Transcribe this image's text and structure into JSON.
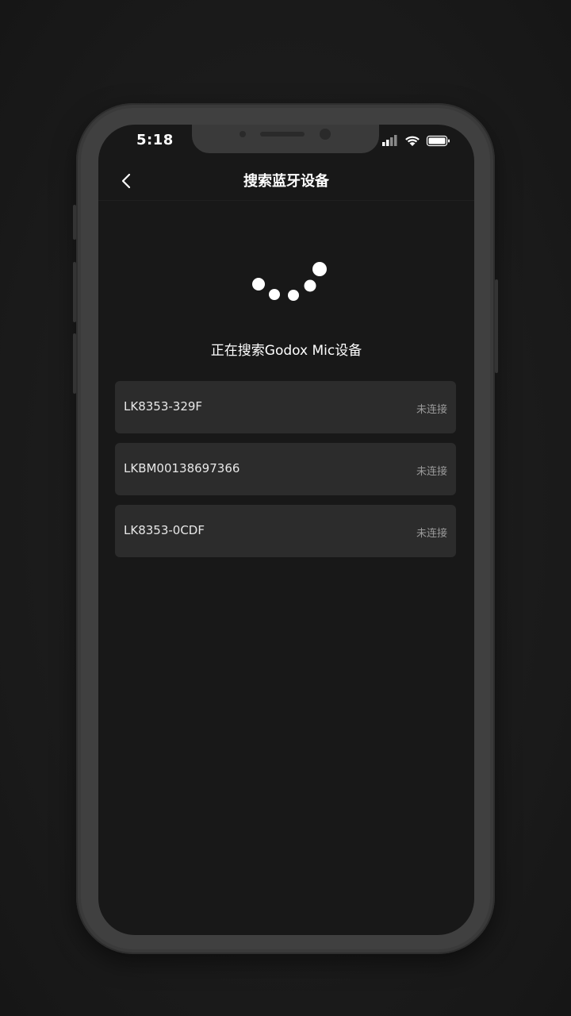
{
  "status_bar": {
    "time": "5:18"
  },
  "nav": {
    "title": "搜索蓝牙设备",
    "back_icon": "chevron-left-icon"
  },
  "search": {
    "status_text": "正在搜索Godox Mic设备"
  },
  "devices": [
    {
      "name": "LK8353-329F",
      "status": "未连接"
    },
    {
      "name": "LKBM00138697366",
      "status": "未连接"
    },
    {
      "name": "LK8353-0CDF",
      "status": "未连接"
    }
  ],
  "colors": {
    "background": "#181818",
    "card": "#2c2c2c",
    "text_primary": "#ffffff",
    "text_secondary": "#9a9a9a"
  }
}
